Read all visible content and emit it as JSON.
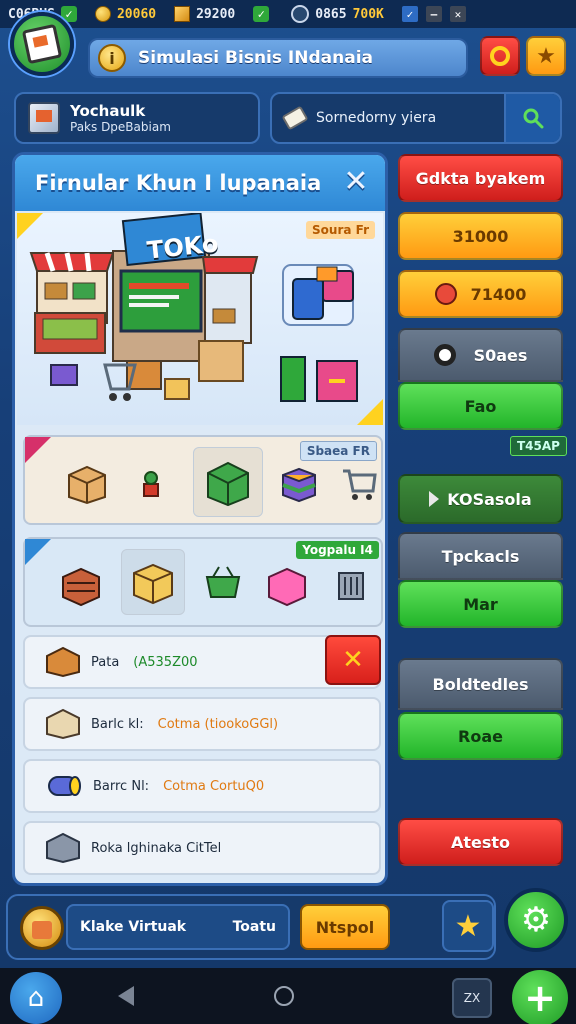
{
  "status_bar": {
    "item1": "C06BUS",
    "coins": "20060",
    "gems": "29200",
    "item4": "0865",
    "item4_highlight": "700K"
  },
  "header": {
    "title": "Simulasi Bisnis INdanaia",
    "info_glyph": "i"
  },
  "shop_chip": {
    "name": "Yochaulk",
    "sub": "Paks DpeBabiam"
  },
  "search": {
    "placeholder": "Sornedorny yiera"
  },
  "modal": {
    "title": "Firnular Khun I lupanaia",
    "hero_badge": "TOKo",
    "hero_tag": "Soura Fr",
    "shelf1_tag": "Sbaea FR",
    "shelf2_tag": "Yogpalu I4",
    "rows": [
      {
        "label": "Pata",
        "value": "(A535Z00"
      },
      {
        "label": "Barlc kl:",
        "value": "Cotma (tiookoGGl)"
      },
      {
        "label": "Barrc Nl:",
        "value": "Cotma CortuQ0"
      },
      {
        "label": "Roka lghinaka CitTel",
        "value": ""
      }
    ]
  },
  "sidebar": {
    "btn1": "Gdkta byakem",
    "btn2": "31000",
    "btn3": "71400",
    "btn4": "S0aes",
    "btn5": "Fao",
    "tag": "T45AP",
    "btn6": "KOSasola",
    "btn7": "Tpckacls",
    "btn8": "Mar",
    "btn9": "Boldtedles",
    "btn10": "Roae",
    "btn11": "Atesto"
  },
  "bottom": {
    "wallet_label": "Klake Virtuak",
    "wallet_value": "Toatu",
    "deposit": "Ntspol"
  },
  "navbar": {
    "gallery_label": "ZX"
  },
  "colors": {
    "accent_blue": "#2f88d5",
    "danger_red": "#d8201b",
    "success_green": "#22b52a",
    "warning_orange": "#ff9a12"
  }
}
